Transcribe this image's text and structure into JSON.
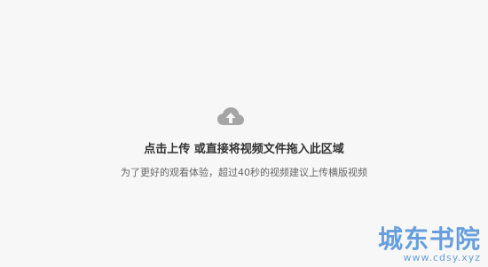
{
  "upload": {
    "icon": "cloud-upload-icon",
    "primary_text": "点击上传 或直接将视频文件拖入此区域",
    "secondary_text": "为了更好的观看体验，超过40秒的视频建议上传横版视频"
  },
  "watermark": {
    "title": "城东书院",
    "url": "www.cdsy.xyz"
  },
  "colors": {
    "background": "#f7f7f7",
    "icon": "#a5a5a5",
    "primary_text": "#333333",
    "secondary_text": "#666666",
    "watermark": "#4f8fd8"
  }
}
